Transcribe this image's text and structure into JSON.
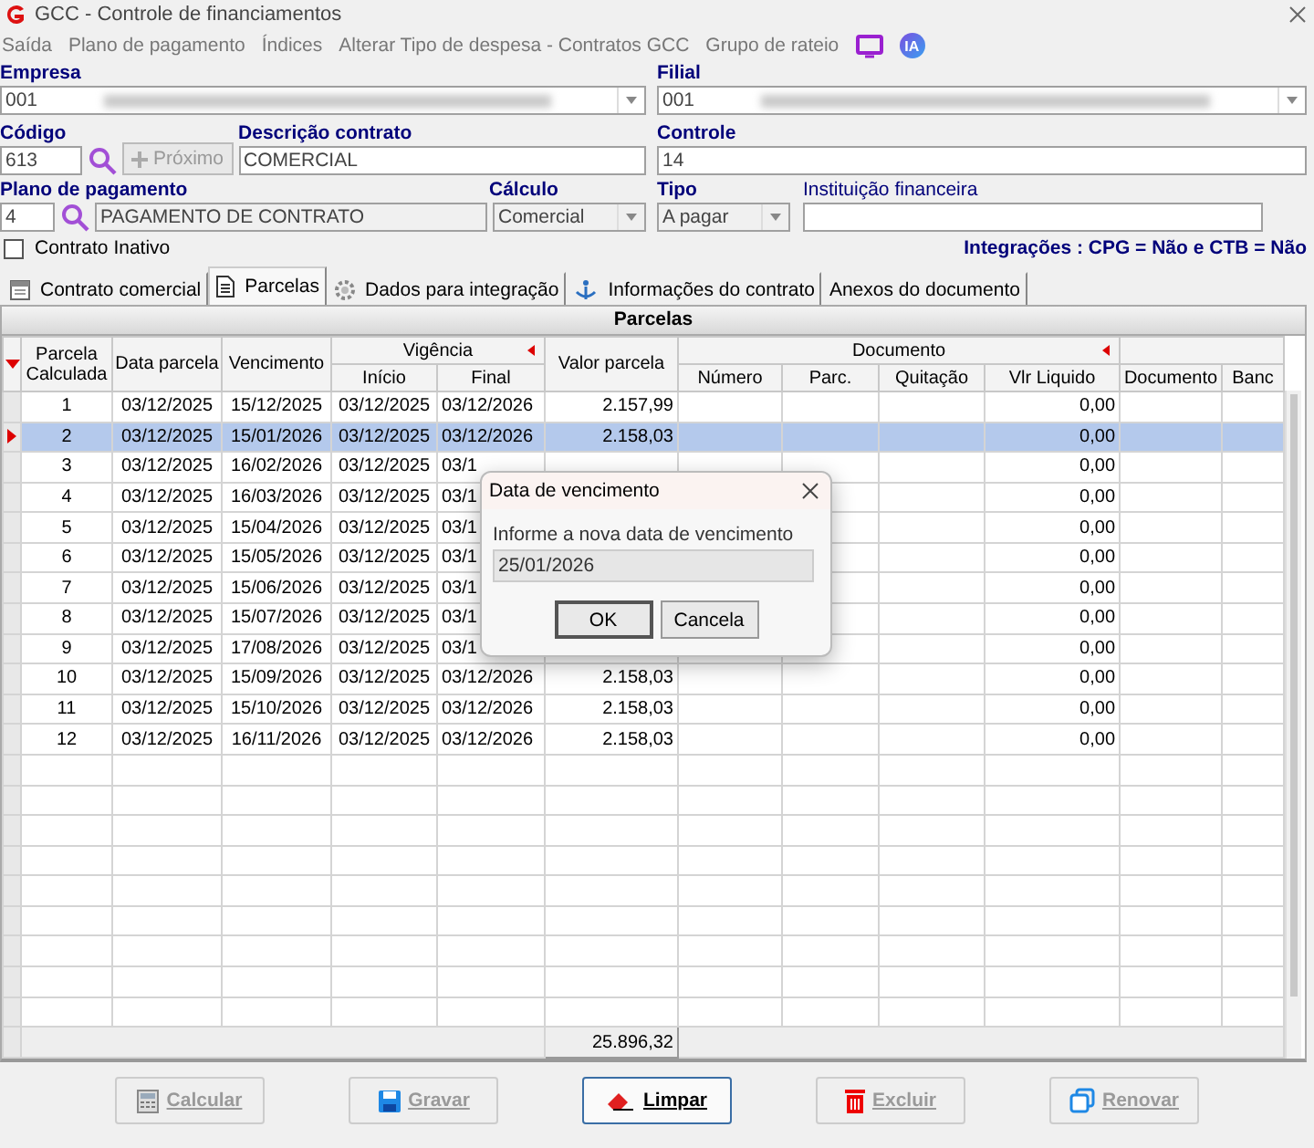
{
  "window": {
    "title": "GCC - Controle de financiamentos"
  },
  "menu": [
    {
      "label": "Saída"
    },
    {
      "label": "Plano de pagamento"
    },
    {
      "label": "Índices"
    },
    {
      "label": "Alterar Tipo de despesa - Contratos GCC"
    },
    {
      "label": "Grupo de rateio"
    }
  ],
  "ia_badge": "IA",
  "form": {
    "empresa": {
      "label": "Empresa",
      "value": "001"
    },
    "filial": {
      "label": "Filial",
      "value": "001"
    },
    "codigo": {
      "label": "Código",
      "value": "613"
    },
    "proximo": {
      "label": "Próximo",
      "disabled": true
    },
    "descricao": {
      "label": "Descrição contrato",
      "value": "COMERCIAL"
    },
    "controle": {
      "label": "Controle",
      "value": "14"
    },
    "plano": {
      "label": "Plano de pagamento",
      "code": "4",
      "value": "PAGAMENTO DE CONTRATO"
    },
    "calculo": {
      "label": "Cálculo",
      "value": "Comercial"
    },
    "tipo": {
      "label": "Tipo",
      "value": "A pagar"
    },
    "instituicao": {
      "label": "Instituição financeira"
    },
    "inativo": {
      "label": "Contrato Inativo",
      "checked": false
    },
    "integracoes": "Integrações : CPG = Não e CTB = Não"
  },
  "tabs": [
    {
      "label": "Contrato comercial",
      "selected": false
    },
    {
      "label": "Parcelas",
      "selected": true
    },
    {
      "label": "Dados para integração",
      "selected": false
    },
    {
      "label": "Informações do contrato",
      "selected": false
    },
    {
      "label": "Anexos do documento",
      "selected": false
    }
  ],
  "table": {
    "title": "Parcelas",
    "groups": {
      "vigencia": "Vigência",
      "documento": "Documento"
    },
    "columns": {
      "parcela": "Parcela Calculada",
      "data_parcela": "Data parcela",
      "vencimento": "Vencimento",
      "inicio": "Início",
      "final": "Final",
      "valor": "Valor parcela",
      "numero": "Número",
      "parc": "Parc.",
      "quitacao": "Quitação",
      "vlr_liquido": "Vlr Liquido",
      "documento": "Documento",
      "banc": "Banc"
    },
    "rows": [
      {
        "selected": false,
        "parcela": "1",
        "data_parcela": "03/12/2025",
        "vencimento": "15/12/2025",
        "inicio": "03/12/2025",
        "final": "03/12/2026",
        "valor": "2.157,99",
        "vlr_liquido": "0,00"
      },
      {
        "selected": true,
        "parcela": "2",
        "data_parcela": "03/12/2025",
        "vencimento": "15/01/2026",
        "inicio": "03/12/2025",
        "final": "03/12/2026",
        "valor": "2.158,03",
        "vlr_liquido": "0,00"
      },
      {
        "selected": false,
        "parcela": "3",
        "data_parcela": "03/12/2025",
        "vencimento": "16/02/2026",
        "inicio": "03/12/2025",
        "final": "03/1",
        "vlr_liquido": "0,00"
      },
      {
        "selected": false,
        "parcela": "4",
        "data_parcela": "03/12/2025",
        "vencimento": "16/03/2026",
        "inicio": "03/12/2025",
        "final": "03/1",
        "vlr_liquido": "0,00"
      },
      {
        "selected": false,
        "parcela": "5",
        "data_parcela": "03/12/2025",
        "vencimento": "15/04/2026",
        "inicio": "03/12/2025",
        "final": "03/1",
        "vlr_liquido": "0,00"
      },
      {
        "selected": false,
        "parcela": "6",
        "data_parcela": "03/12/2025",
        "vencimento": "15/05/2026",
        "inicio": "03/12/2025",
        "final": "03/1",
        "vlr_liquido": "0,00"
      },
      {
        "selected": false,
        "parcela": "7",
        "data_parcela": "03/12/2025",
        "vencimento": "15/06/2026",
        "inicio": "03/12/2025",
        "final": "03/1",
        "vlr_liquido": "0,00"
      },
      {
        "selected": false,
        "parcela": "8",
        "data_parcela": "03/12/2025",
        "vencimento": "15/07/2026",
        "inicio": "03/12/2025",
        "final": "03/1",
        "vlr_liquido": "0,00"
      },
      {
        "selected": false,
        "parcela": "9",
        "data_parcela": "03/12/2025",
        "vencimento": "17/08/2026",
        "inicio": "03/12/2025",
        "final": "03/1",
        "vlr_liquido": "0,00"
      },
      {
        "selected": false,
        "parcela": "10",
        "data_parcela": "03/12/2025",
        "vencimento": "15/09/2026",
        "inicio": "03/12/2025",
        "final": "03/12/2026",
        "valor": "2.158,03",
        "vlr_liquido": "0,00"
      },
      {
        "selected": false,
        "parcela": "11",
        "data_parcela": "03/12/2025",
        "vencimento": "15/10/2026",
        "inicio": "03/12/2025",
        "final": "03/12/2026",
        "valor": "2.158,03",
        "vlr_liquido": "0,00"
      },
      {
        "selected": false,
        "parcela": "12",
        "data_parcela": "03/12/2025",
        "vencimento": "16/11/2026",
        "inicio": "03/12/2025",
        "final": "03/12/2026",
        "valor": "2.158,03",
        "vlr_liquido": "0,00"
      }
    ],
    "total": "25.896,32"
  },
  "dialog": {
    "title": "Data de vencimento",
    "prompt": "Informe a nova data de vencimento",
    "value": "25/01/2026",
    "buttons": [
      {
        "label": "OK",
        "default": true
      },
      {
        "label": "Cancela",
        "default": false
      }
    ]
  },
  "buttons": [
    {
      "label": "Calcular",
      "disabled": true
    },
    {
      "label": "Gravar",
      "disabled": true
    },
    {
      "label": "Limpar",
      "disabled": false
    },
    {
      "label": "Excluir",
      "disabled": true
    },
    {
      "label": "Renovar",
      "disabled": true
    }
  ]
}
